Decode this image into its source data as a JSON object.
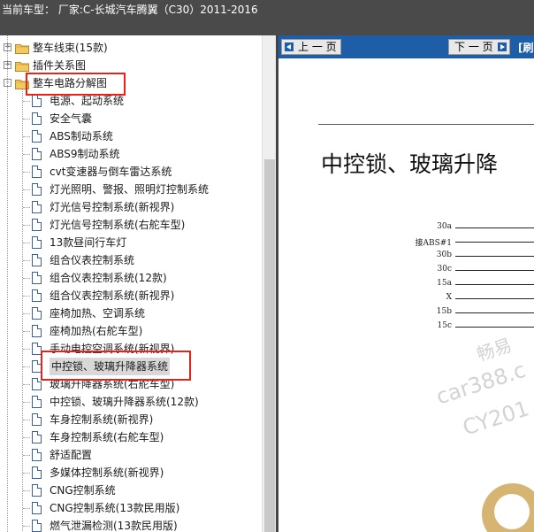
{
  "header": {
    "label": "当前车型：  厂家:C-长城汽车腾翼（C30）2011-2016"
  },
  "tree": {
    "folders": [
      {
        "label": "整车线束(15款)",
        "expander": "+"
      },
      {
        "label": "插件关系图",
        "expander": "+"
      },
      {
        "label": "整车电路分解图",
        "expander": "-"
      }
    ],
    "items": [
      "电源、起动系统",
      "安全气囊",
      "ABS制动系统",
      "ABS9制动系统",
      "cvt变速器与倒车雷达系统",
      "灯光照明、警报、照明灯控制系统",
      "灯光信号控制系统(新视界)",
      "灯光信号控制系统(右舵车型)",
      "13款昼间行车灯",
      "组合仪表控制系统",
      "组合仪表控制系统(12款)",
      "组合仪表控制系统(新视界)",
      "座椅加热、空调系统",
      "座椅加热(右舵车型)",
      "手动电控空调系统(新视界)",
      "中控锁、玻璃升降器系统",
      "玻璃升降器系统(右舵车型)",
      "中控锁、玻璃升降器系统(12款)",
      "车身控制系统(新视界)",
      "车身控制系统(右舵车型)",
      "舒适配置",
      "多媒体控制系统(新视界)",
      "CNG控制系统",
      "CNG控制系统(13款民用版)",
      "燃气泄漏检测(13款民用版)"
    ],
    "selected_index": 15,
    "folder_icon": "folder-icon",
    "item_icon": "document-icon"
  },
  "viewer": {
    "prev_label": "上 一 页",
    "next_label": "下 一 页",
    "extra_label": "[刷",
    "doc_title": "中控锁、玻璃升降",
    "wires": [
      "30a",
      "接ABS#1",
      "30b",
      "30c",
      "15a",
      "X",
      "15b",
      "15c"
    ],
    "watermark": [
      "畅易",
      "car388.c",
      "CY201"
    ]
  },
  "colors": {
    "header_bg": "#4a4a4a",
    "toolbar_bg": "#1d5ea7",
    "highlight_box": "#e2241d",
    "selected_bg": "#d8d8d8"
  }
}
